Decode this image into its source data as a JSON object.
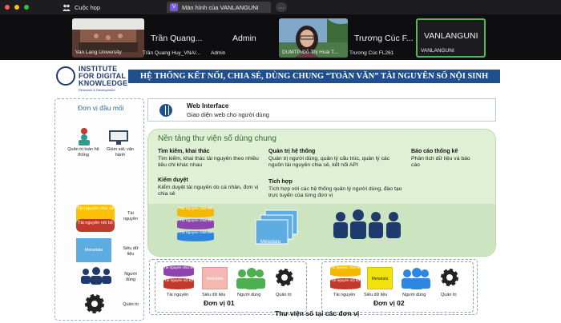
{
  "window": {
    "tab1_label": "Cuộc họp",
    "tab2_badge": "V",
    "tab2_label": "Màn hình của VANLANGUNI",
    "more_label": "···"
  },
  "participants": [
    {
      "name": "Trần Quang...",
      "caption": "Van Lang University",
      "caption2": "Trần Quang Huy_VNA/..."
    },
    {
      "name": "Admin",
      "caption": "Admin"
    },
    {
      "name": "Trương Cúc F...",
      "caption": "DUMTP-Đỗ Thị Hoài T...",
      "caption2": "Trương Cúc FL261"
    },
    {
      "name": "VANLANGUNI",
      "caption": "VANLANGUNI"
    }
  ],
  "slide": {
    "logo_lines": [
      "INSTITUTE",
      "FOR DIGITAL",
      "KNOWLEDGE"
    ],
    "logo_sub": "Research & Development",
    "banner": "HỆ THỐNG KẾT NỐI, CHIA SẺ, DÙNG CHUNG “TOÀN VĂN” TÀI NGUYÊN SỐ NỘI SINH",
    "left_panel": {
      "title": "Đơn vị đầu mối",
      "admin_label": "Quản trị toàn hệ thống",
      "monitor_label": "Giám sát, vận hành",
      "db_labels": [
        "Tài nguyên chia sẻ",
        "Tài nguyên nội bộ"
      ],
      "resources_label": "Tài nguyên",
      "metadata": "Metadata",
      "metadata_label": "Siêu dữ liệu",
      "users_label": "Người dùng",
      "manage_label": "Quản trị"
    },
    "web_interface": {
      "title": "Web Interface",
      "subtitle": "Giao diện web cho người dùng"
    },
    "platform": {
      "title": "Nền tảng thư viện số dùng chung",
      "features": [
        {
          "head": "Tìm kiếm, khai thác",
          "text": "Tìm kiếm, khai thác tài nguyên theo nhiều tiêu chí khác nhau"
        },
        {
          "head": "Quản trị hệ thống",
          "text": "Quản trị người dùng, quản lý cấu trúc, quản lý các nguồn tài nguyên chia sẻ, kết nối API"
        },
        {
          "head": "Báo cáo thống kê",
          "text": "Phân tích dữ liệu và báo cáo"
        },
        {
          "head": "Kiểm duyệt",
          "text": "Kiểm duyệt tài nguyên do cá nhân, đơn vị chia sẻ"
        },
        {
          "head": "Tích hợp",
          "text": "Tích hợp với các hệ thống quản lý người dùng, đào tạo trực tuyến của từng đơn vị"
        }
      ],
      "db_labels": [
        "Tài nguyên chia sẻ",
        "Tài nguyên chia sẻ",
        "Tài nguyên chia sẻ"
      ],
      "metadata": "Metadata"
    },
    "units": [
      {
        "name": "Đơn vị 01",
        "labels": [
          "Tài nguyên",
          "Siêu dữ liệu",
          "Người dùng",
          "Quản trị"
        ],
        "db_labels": [
          "Tài nguyên chia sẻ",
          "Tài nguyên nội bộ"
        ],
        "metadata": "Metadata"
      },
      {
        "name": "Đơn vị 02",
        "labels": [
          "Tài nguyên",
          "Siêu dữ liệu",
          "Người dùng",
          "Quản trị"
        ],
        "db_labels": [
          "Tài nguyên chia sẻ",
          "Tài nguyên nội bộ"
        ],
        "metadata": "Metadata"
      }
    ],
    "bottom_caption": "Thư viện số tại các đơn vị"
  }
}
